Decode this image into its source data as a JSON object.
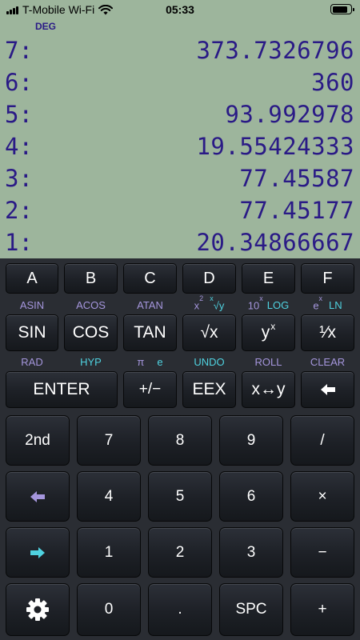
{
  "status_bar": {
    "carrier": "T-Mobile Wi-Fi",
    "time": "05:33",
    "signal_icon": "signal-bars-icon",
    "wifi_icon": "wifi-icon",
    "battery_icon": "battery-icon",
    "battery_level": 0.85
  },
  "display": {
    "angle_mode": "DEG",
    "stack": [
      {
        "level": "7:",
        "value": "373.7326796"
      },
      {
        "level": "6:",
        "value": "360"
      },
      {
        "level": "5:",
        "value": "93.992978"
      },
      {
        "level": "4:",
        "value": "19.55424333"
      },
      {
        "level": "3:",
        "value": "77.45587"
      },
      {
        "level": "2:",
        "value": "77.45177"
      },
      {
        "level": "1:",
        "value": "20.34866667"
      }
    ]
  },
  "keys": {
    "row_letters": [
      "A",
      "B",
      "C",
      "D",
      "E",
      "F"
    ],
    "shift_row1": {
      "asin": "ASIN",
      "acos": "ACOS",
      "atan": "ATAN",
      "x2_base": "x",
      "x2_exp": "2",
      "xroot_exp": "x",
      "xroot_base": "√y",
      "tenx_base": "10",
      "tenx_exp": "x",
      "log": "LOG",
      "ex_base": "e",
      "ex_exp": "x",
      "ln": "LN"
    },
    "func_row": {
      "sin": "SIN",
      "cos": "COS",
      "tan": "TAN",
      "sqrt": "√x",
      "power_base": "y",
      "power_exp": "x",
      "reciprocal": "¹⁄x"
    },
    "shift_row2": {
      "rad": "RAD",
      "hyp": "HYP",
      "pi": "π",
      "e": "e",
      "undo": "UNDO",
      "roll": "ROLL",
      "clear": "CLEAR"
    },
    "enter_row": {
      "enter": "ENTER",
      "chs": "+/−",
      "eex": "EEX",
      "swap": "x↔y",
      "backspace_icon": "backspace-arrow-icon"
    },
    "keypad_rows": [
      [
        "2nd",
        "7",
        "8",
        "9",
        "/"
      ],
      [
        "shift-left-icon",
        "4",
        "5",
        "6",
        "×"
      ],
      [
        "shift-right-icon",
        "1",
        "2",
        "3",
        "−"
      ],
      [
        "gear-icon",
        "0",
        ".",
        "SPC",
        "+"
      ]
    ]
  },
  "colors": {
    "lcd_background": "#9db59c",
    "lcd_text": "#2a1a86",
    "shift_purple": "#a596dd",
    "shift_cyan": "#4fd2e0"
  }
}
